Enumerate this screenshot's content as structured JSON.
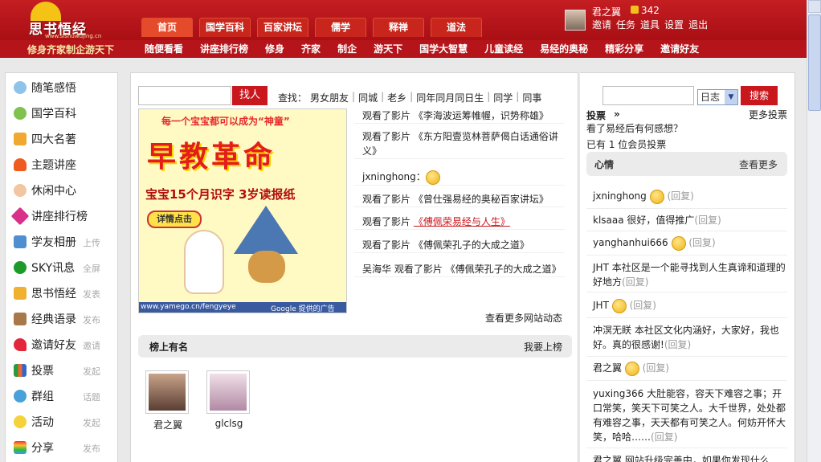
{
  "header": {
    "logo_text": "思书悟经",
    "logo_url": "www.sishuwujing.cn",
    "slogan": "修身齐家制企游天下",
    "main_tabs": [
      "首页",
      "国学百科",
      "百家讲坛",
      "儒学",
      "释禅",
      "道法"
    ],
    "sub_nav": [
      "随便看看",
      "讲座排行榜",
      "修身",
      "齐家",
      "制企",
      "游天下",
      "国学大智慧",
      "儿童读经",
      "易经的奥秘",
      "精彩分享",
      "邀请好友"
    ],
    "user": {
      "name": "君之翼",
      "points": "342",
      "links": [
        "邀请",
        "任务",
        "道具",
        "设置",
        "退出"
      ]
    }
  },
  "sidebar": {
    "items": [
      {
        "label": "随笔感悟",
        "icon": "speech-bubble-icon",
        "extra": ""
      },
      {
        "label": "国学百科",
        "icon": "flower-icon",
        "extra": ""
      },
      {
        "label": "四大名著",
        "icon": "bag-icon",
        "extra": ""
      },
      {
        "label": "主题讲座",
        "icon": "flame-icon",
        "extra": ""
      },
      {
        "label": "休闲中心",
        "icon": "face-icon",
        "extra": ""
      },
      {
        "label": "讲座排行榜",
        "icon": "star-icon",
        "extra": ""
      },
      {
        "label": "学友相册",
        "icon": "photo-icon",
        "extra": "上传"
      },
      {
        "label": "SKY讯息",
        "icon": "sky-icon",
        "extra": "全屏"
      },
      {
        "label": "思书悟经",
        "icon": "book-icon",
        "extra": "发表"
      },
      {
        "label": "经典语录",
        "icon": "quote-icon",
        "extra": "发布"
      },
      {
        "label": "邀请好友",
        "icon": "heart-icon",
        "extra": "邀请"
      },
      {
        "label": "投票",
        "icon": "bar-chart-icon",
        "extra": "发起"
      },
      {
        "label": "群组",
        "icon": "group-icon",
        "extra": "话题"
      },
      {
        "label": "活动",
        "icon": "bulb-icon",
        "extra": "发起"
      },
      {
        "label": "分享",
        "icon": "rainbow-icon",
        "extra": "发布"
      }
    ]
  },
  "main": {
    "search_button": "找人",
    "find_label": "查找：",
    "find_links": [
      "男女朋友",
      "同城",
      "老乡",
      "同年同月同日生",
      "同学",
      "同事"
    ],
    "ad": {
      "line1": "每一个宝宝都可以成为“神童”",
      "big": "早教革命",
      "line2": "宝宝15个月识字  3岁读报纸",
      "cta": "详情点击",
      "url": "www.yamego.cn/fengyeye",
      "google": "Google 提供的广告"
    },
    "feed": [
      {
        "text": "观看了影片 《李海波运筹帷幄，识势称雄》",
        "highlight": ""
      },
      {
        "text": "观看了影片 《东方阳壹览林菩萨偈白话通俗讲义》",
        "highlight": ""
      },
      {
        "text": "jxninghong：",
        "highlight": "",
        "smile": true
      },
      {
        "text": "观看了影片 《曾仕强易经的奥秘百家讲坛》",
        "highlight": ""
      },
      {
        "text": "观看了影片 ",
        "highlight": "《傅佩荣易经与人生》"
      },
      {
        "text": "观看了影片 《傅佩荣孔子的大成之道》",
        "highlight": ""
      },
      {
        "text": "吴海华 观看了影片 《傅佩荣孔子的大成之道》",
        "highlight": ""
      }
    ],
    "feed_more": "查看更多网站动态",
    "ranking_title": "榜上有名",
    "ranking_more": "我要上榜",
    "ranking_users": [
      "君之翼",
      "glclsg"
    ]
  },
  "right": {
    "search_button": "搜索",
    "select_value": "日志",
    "vote_title": "投票",
    "vote_arrow": "»",
    "vote_more": "更多投票",
    "vote_question": "看了易经后有何感想？",
    "vote_count": "已有  1 位会员投票",
    "mood_title": "心情",
    "mood_more": "查看更多",
    "reply_label": "(回复)",
    "moods": [
      {
        "text": "jxninghong",
        "smile": true
      },
      {
        "text": "klsaaa 很好，值得推广",
        "smile": false
      },
      {
        "text": "yanghanhui666",
        "smile": true
      },
      {
        "text": "JHT 本社区是一个能寻找到人生真谛和道理的好地方",
        "smile": false
      },
      {
        "text": "JHT",
        "smile": true
      },
      {
        "text": "冲溟无眹 本社区文化内涵好，大家好，我也好。真的很感谢!",
        "smile": false
      },
      {
        "text": "君之翼",
        "smile": true
      },
      {
        "text": "yuxing366 大肚能容，容天下难容之事；开口常笑，笑天下可笑之人。大千世界，处处都有难容之事，天天都有可笑之人。何妨开怀大笑，哈哈……",
        "smile": false
      },
      {
        "text": "君之翼 网站升级完善中，如果你发现什么",
        "smile": false
      }
    ]
  }
}
